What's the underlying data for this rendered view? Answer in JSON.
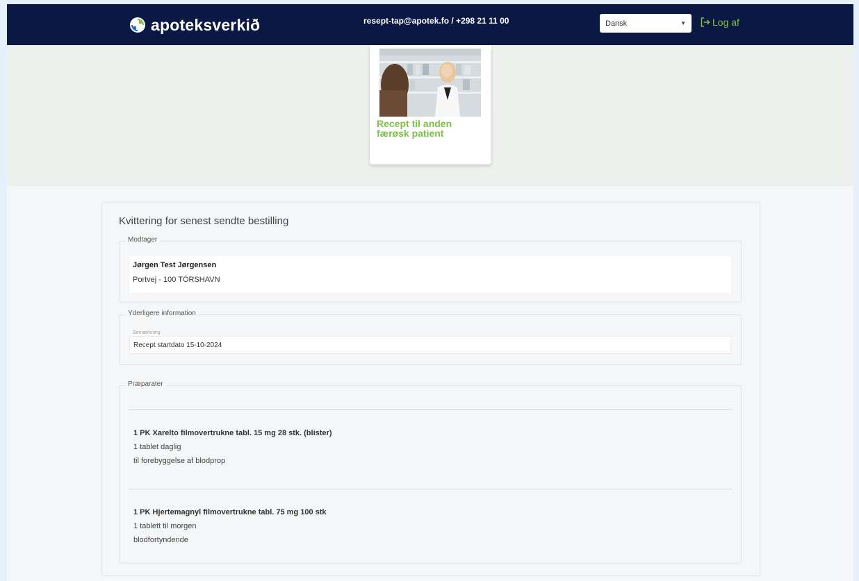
{
  "header": {
    "brand": "apoteksverkið",
    "contact": "resept-tap@apotek.fo / +298 21 11 00",
    "language": {
      "selected": "Dansk"
    },
    "logout_label": "Log af"
  },
  "card": {
    "title": "Recept til anden færøsk patient"
  },
  "receipt": {
    "title": "Kvittering for senest sendte bestilling",
    "recipient": {
      "legend": "Modtager",
      "name": "Jørgen Test Jørgensen",
      "address": "Portvej - 100 TÓRSHAVN"
    },
    "additional": {
      "legend": "Yderligere information",
      "remark_label": "Bemærkning",
      "remark_value": "Recept startdato 15-10-2024"
    },
    "products": {
      "legend": "Præparater",
      "items": [
        {
          "name": "1 PK Xarelto filmovertrukne tabl. 15 mg 28 stk. (blister)",
          "dosage": "1 tablet daglig",
          "purpose": "til forebyggelse af blodprop"
        },
        {
          "name": "1 PK Hjertemagnyl filmovertrukne tabl. 75 mg 100 stk",
          "dosage": "1 tablett til morgen",
          "purpose": "blodfortyndende"
        }
      ]
    }
  },
  "colors": {
    "navy": "#0b1843",
    "green": "#7cc141"
  }
}
